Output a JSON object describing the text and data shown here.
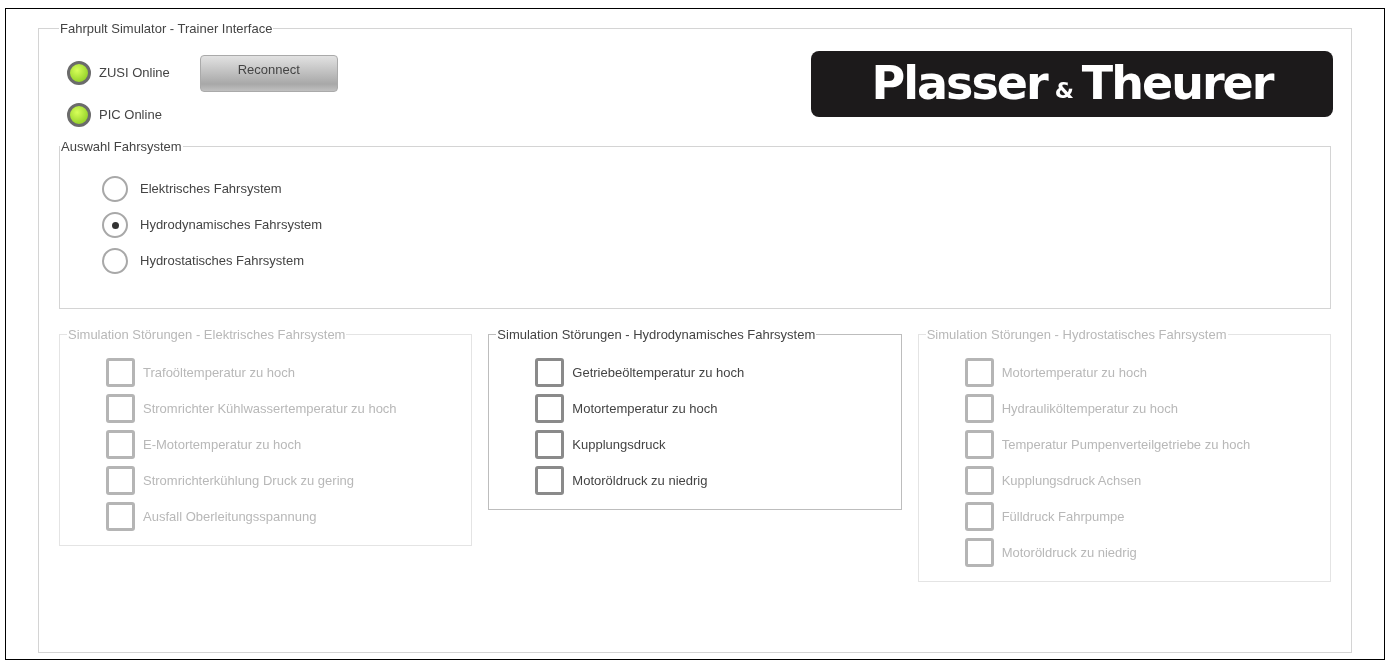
{
  "main_group": {
    "title": "Fahrpult Simulator - Trainer Interface"
  },
  "status": [
    {
      "label": "ZUSI Online",
      "on": true
    },
    {
      "label": "PIC Online",
      "on": true
    }
  ],
  "reconnect_button": {
    "label": "Reconnect"
  },
  "logo": {
    "parts": [
      "Plasser",
      "&",
      "Theurer"
    ]
  },
  "system_select": {
    "title": "Auswahl Fahrsystem",
    "options": [
      {
        "label": "Elektrisches Fahrsystem",
        "selected": false
      },
      {
        "label": "Hydrodynamisches Fahrsystem",
        "selected": true
      },
      {
        "label": "Hydrostatisches Fahrsystem",
        "selected": false
      }
    ]
  },
  "fault_groups": [
    {
      "title": "Simulation Störungen - Elektrisches Fahrsystem",
      "disabled": true,
      "items": [
        {
          "label": "Trafoöltemperatur zu hoch",
          "checked": false
        },
        {
          "label": "Stromrichter Kühlwassertemperatur zu hoch",
          "checked": false
        },
        {
          "label": "E-Motortemperatur zu hoch",
          "checked": false
        },
        {
          "label": "Stromrichterkühlung Druck zu gering",
          "checked": false
        },
        {
          "label": "Ausfall Oberleitungsspannung",
          "checked": false
        }
      ]
    },
    {
      "title": "Simulation Störungen - Hydrodynamisches Fahrsystem",
      "disabled": false,
      "items": [
        {
          "label": "Getriebeöltemperatur zu hoch",
          "checked": false
        },
        {
          "label": "Motortemperatur zu hoch",
          "checked": false
        },
        {
          "label": "Kupplungsdruck",
          "checked": false
        },
        {
          "label": "Motoröldruck zu niedrig",
          "checked": false
        }
      ]
    },
    {
      "title": "Simulation Störungen - Hydrostatisches Fahrsystem",
      "disabled": true,
      "items": [
        {
          "label": "Motortemperatur zu hoch",
          "checked": false
        },
        {
          "label": "Hydrauliköltemperatur zu hoch",
          "checked": false
        },
        {
          "label": "Temperatur Pumpenverteilgetriebe zu hoch",
          "checked": false
        },
        {
          "label": "Kupplungsdruck Achsen",
          "checked": false
        },
        {
          "label": "Fülldruck Fahrpumpe",
          "checked": false
        },
        {
          "label": "Motoröldruck zu niedrig",
          "checked": false
        }
      ]
    }
  ]
}
